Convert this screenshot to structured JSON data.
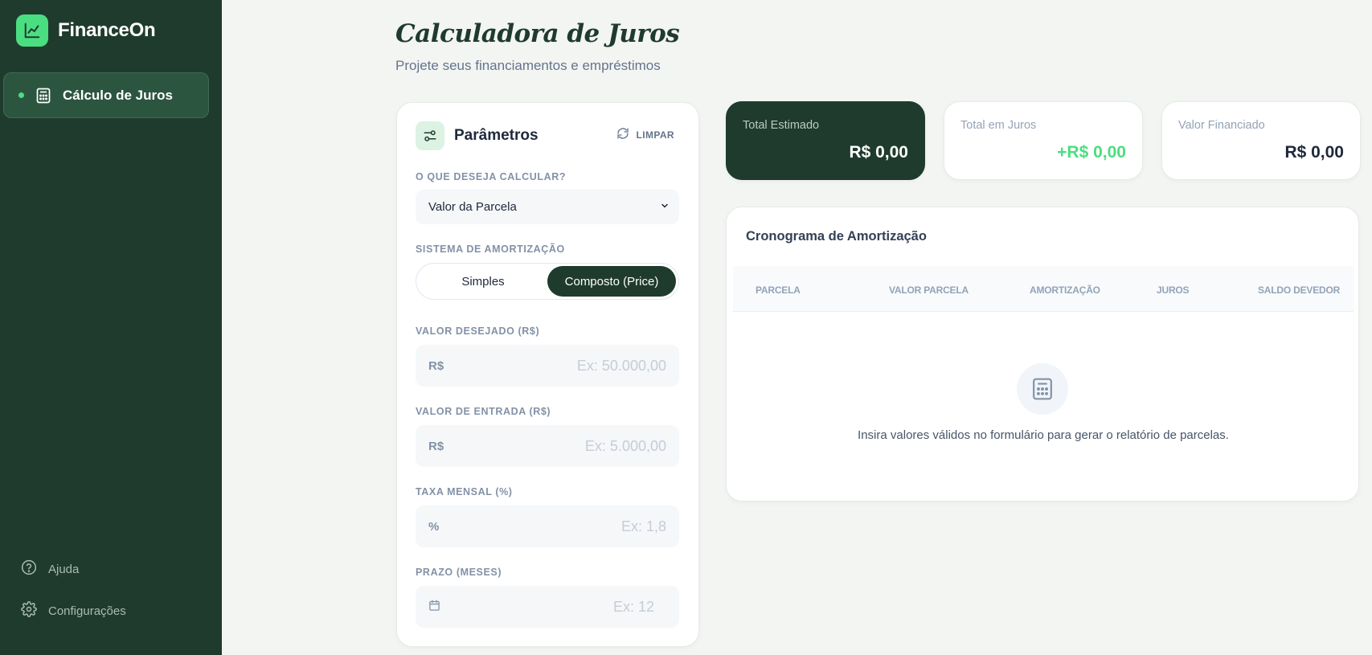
{
  "brand": {
    "name": "FinanceOn",
    "icon": "chart-line-icon"
  },
  "sidebar": {
    "active_item": {
      "label": "Cálculo de Juros",
      "icon": "calculator-icon"
    },
    "footer": [
      {
        "label": "Ajuda",
        "icon": "help-circle-icon"
      },
      {
        "label": "Configurações",
        "icon": "gear-icon"
      }
    ]
  },
  "header": {
    "title": "Calculadora de Juros",
    "subtitle": "Projete seus financiamentos e empréstimos"
  },
  "params": {
    "title": "Parâmetros",
    "clear_label": "LIMPAR",
    "calc_type": {
      "label": "O QUE DESEJA CALCULAR?",
      "selected": "Valor da Parcela"
    },
    "system": {
      "label": "SISTEMA DE AMORTIZAÇÃO",
      "options": [
        "Simples",
        "Composto (Price)"
      ],
      "selected": "Composto (Price)"
    },
    "fields": [
      {
        "label": "VALOR DESEJADO (R$)",
        "prefix": "R$",
        "placeholder": "Ex: 50.000,00"
      },
      {
        "label": "VALOR DE ENTRADA (R$)",
        "prefix": "R$",
        "placeholder": "Ex: 5.000,00"
      },
      {
        "label": "TAXA MENSAL (%)",
        "prefix": "%",
        "placeholder": "Ex: 1,8"
      },
      {
        "label": "PRAZO (MESES)",
        "prefix_icon": "calendar-icon",
        "placeholder": "Ex: 12"
      }
    ]
  },
  "stats": [
    {
      "label": "Total Estimado",
      "value": "R$ 0,00"
    },
    {
      "label": "Total em Juros",
      "value": "+R$ 0,00"
    },
    {
      "label": "Valor Financiado",
      "value": "R$ 0,00"
    }
  ],
  "schedule": {
    "title": "Cronograma de Amortização",
    "columns": [
      "PARCELA",
      "VALOR PARCELA",
      "AMORTIZAÇÃO",
      "JUROS",
      "SALDO DEVEDOR"
    ],
    "empty_message": "Insira valores válidos no formulário para gerar o relatório de parcelas."
  },
  "colors": {
    "sidebar": "#1f3b2e",
    "accent": "#4ade80",
    "background": "#f3f5f3"
  }
}
